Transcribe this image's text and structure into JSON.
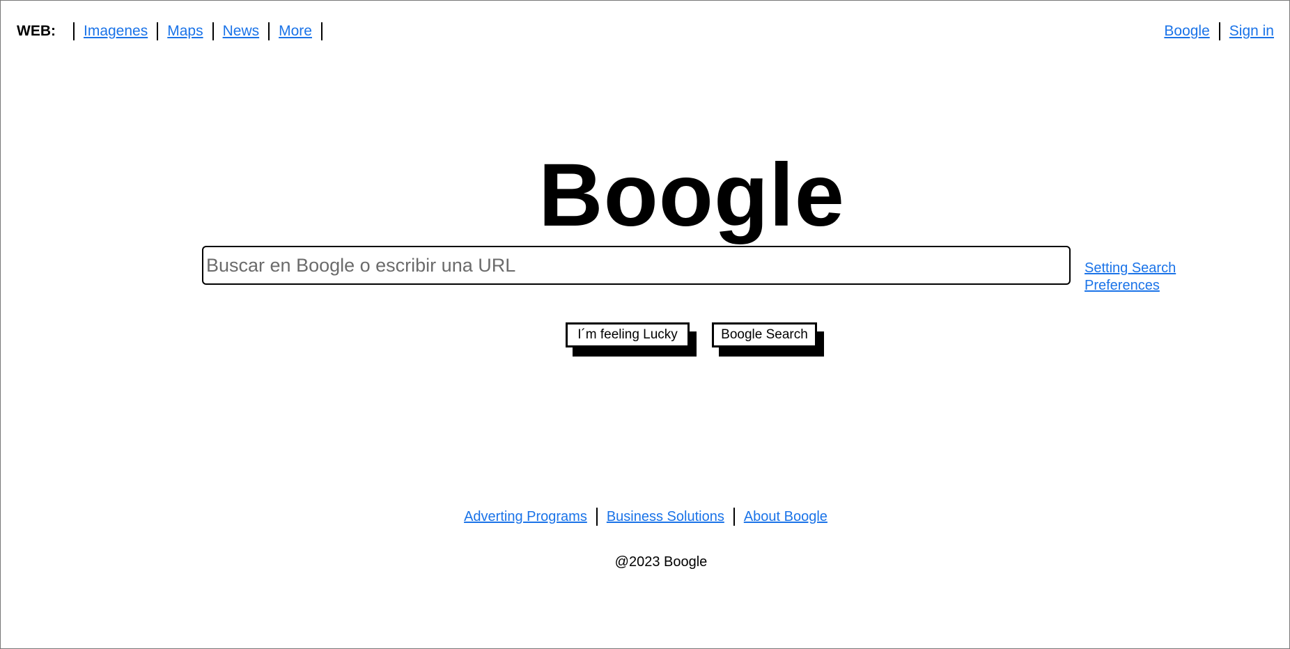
{
  "topnav": {
    "web_label": "WEB:",
    "links": [
      "Imagenes",
      "Maps",
      "News",
      "More"
    ]
  },
  "topright": {
    "links": [
      "Boogle",
      "Sign in"
    ]
  },
  "logo": {
    "text": "Boogle"
  },
  "search": {
    "placeholder": "Buscar en Boogle o escribir una URL",
    "value": ""
  },
  "preferences": {
    "line1": "Setting Search",
    "line2": "Preferences"
  },
  "buttons": {
    "lucky": "I´m feeling Lucky",
    "search": "Boogle Search"
  },
  "footer": {
    "links": [
      "Adverting Programs",
      "Business Solutions",
      "About Boogle"
    ],
    "copyright": "@2023 Boogle"
  },
  "colors": {
    "link": "#1a73e8",
    "text": "#000000",
    "background": "#ffffff"
  }
}
